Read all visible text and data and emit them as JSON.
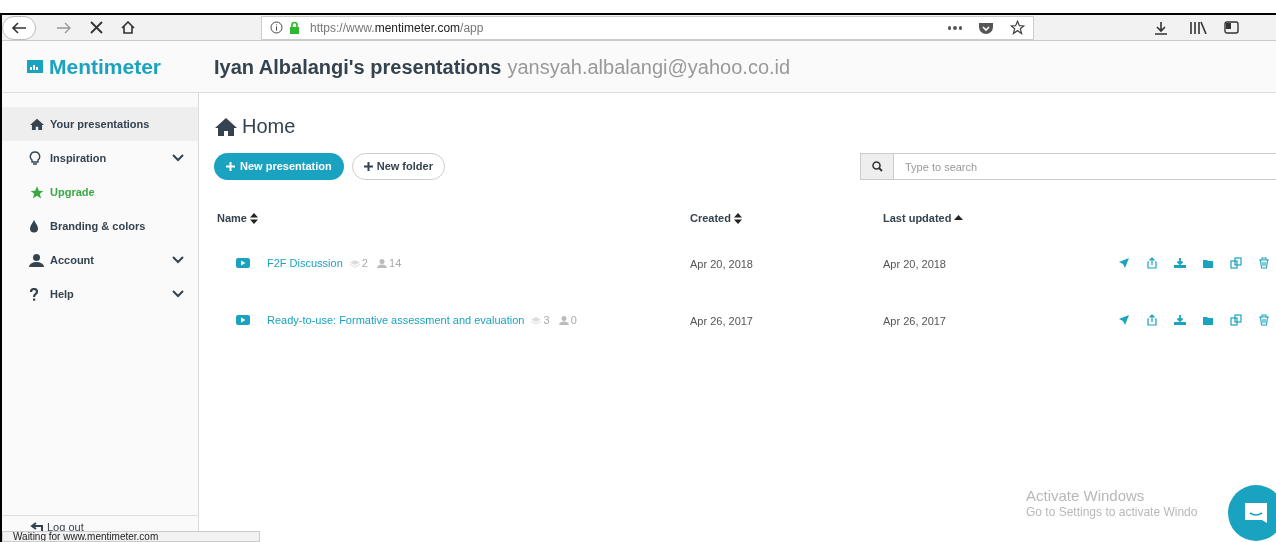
{
  "browser": {
    "url_prefix": "https://www.",
    "url_domain": "mentimeter.com",
    "url_path": "/app"
  },
  "logo": "Mentimeter",
  "header": {
    "title": "Iyan Albalangi's presentations",
    "email": "yansyah.albalangi@yahoo.co.id"
  },
  "sidebar": {
    "items": [
      {
        "label": "Your presentations",
        "kind": "home",
        "selected": true,
        "expandable": false
      },
      {
        "label": "Inspiration",
        "kind": "bulb",
        "selected": false,
        "expandable": true
      },
      {
        "label": "Upgrade",
        "kind": "star",
        "selected": false,
        "expandable": false
      },
      {
        "label": "Branding & colors",
        "kind": "drop",
        "selected": false,
        "expandable": false
      },
      {
        "label": "Account",
        "kind": "user",
        "selected": false,
        "expandable": true
      },
      {
        "label": "Help",
        "kind": "help",
        "selected": false,
        "expandable": true
      }
    ],
    "logout": "Log out"
  },
  "page_title": "Home",
  "buttons": {
    "new_presentation": "New presentation",
    "new_folder": "New folder"
  },
  "search": {
    "placeholder": "Type to search"
  },
  "table": {
    "columns": [
      {
        "label": "Name",
        "sorted": false
      },
      {
        "label": "Created",
        "sorted": false
      },
      {
        "label": "Last updated",
        "sorted": true
      }
    ],
    "rows": [
      {
        "name": "F2F Discussion",
        "slides": "2",
        "votes": "14",
        "created": "Apr 20, 2018",
        "updated": "Apr 20, 2018"
      },
      {
        "name": "Ready-to-use: Formative assessment and evaluation",
        "slides": "3",
        "votes": "0",
        "created": "Apr 26, 2017",
        "updated": "Apr 26, 2017"
      }
    ]
  },
  "status_bar": "Waiting for www.mentimeter.com",
  "activation": {
    "title": "Activate Windows",
    "subtitle": "Go to Settings to activate Windo"
  }
}
